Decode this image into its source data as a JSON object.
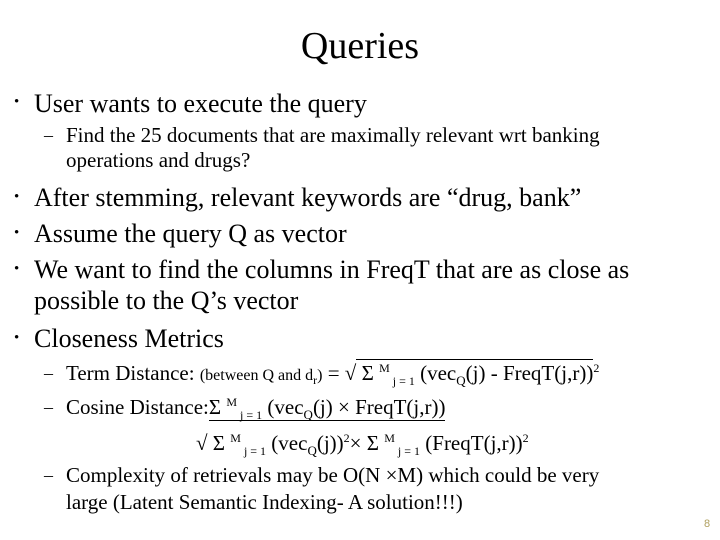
{
  "slide": {
    "title": "Queries",
    "page_number": "8",
    "accent_color": "#b0a060",
    "bullet_glyph": "•",
    "dash_glyph": "–",
    "bullets": [
      {
        "text": "User wants to execute the query",
        "sub": [
          "Find the 25 documents that are maximally relevant wrt banking",
          "operations and drugs?"
        ]
      },
      {
        "text": "After stemming, relevant keywords are “drug, bank”"
      },
      {
        "text": "Assume the query Q as vector"
      },
      {
        "text_lines": [
          "We want to find the columns in FreqT that are as close as",
          "possible to the Q’s vector"
        ]
      },
      {
        "text": "Closeness Metrics"
      }
    ],
    "metrics": {
      "term_distance": {
        "label": "Term Distance:",
        "qualifier": "(between Q and d",
        "qualifier_sub": "r",
        "qualifier_end": ")",
        "equals": " = ",
        "sqrt": "√",
        "sigma": " Σ ",
        "sigma_sup": "M",
        "sigma_sub": "j = 1",
        "expr_a": " (vec",
        "expr_sub": "Q",
        "expr_b": "(j) - FreqT(j,r))",
        "expr_sup": "2"
      },
      "cosine_distance": {
        "label": "Cosine Distance:",
        "num_sigma": "Σ ",
        "num_sigma_sup": "M",
        "num_sigma_sub": "j = 1",
        "num_a": " (vec",
        "num_sub": "Q",
        "num_b": "(j) × FreqT(j,r))",
        "den_sqrt": "√",
        "den_sigma1": " Σ ",
        "den_sigma1_sup": "M",
        "den_sigma1_sub": "j = 1",
        "den_a": " (vec",
        "den_a_sub": "Q",
        "den_b": "(j))",
        "den_b_sup": "2",
        "den_times": "× Σ ",
        "den_sigma2_sup": "M",
        "den_sigma2_sub": "j = 1",
        "den_c": " (FreqT(j,r))",
        "den_c_sup": "2"
      },
      "complexity": {
        "lines": [
          "Complexity of retrievals may be O(N ×M) which could be very",
          "large (Latent Semantic Indexing- A solution!!!)"
        ]
      }
    }
  }
}
